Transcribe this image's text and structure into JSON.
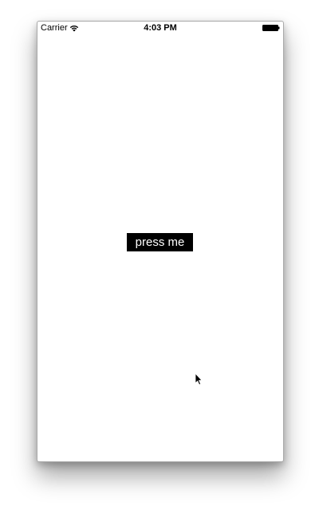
{
  "status_bar": {
    "carrier": "Carrier",
    "time": "4:03 PM",
    "wifi_icon": "wifi-icon",
    "battery_icon": "battery-icon"
  },
  "main": {
    "button_label": "press me"
  },
  "colors": {
    "button_background": "#000000",
    "button_text": "#ffffff",
    "screen_background": "#ffffff"
  }
}
